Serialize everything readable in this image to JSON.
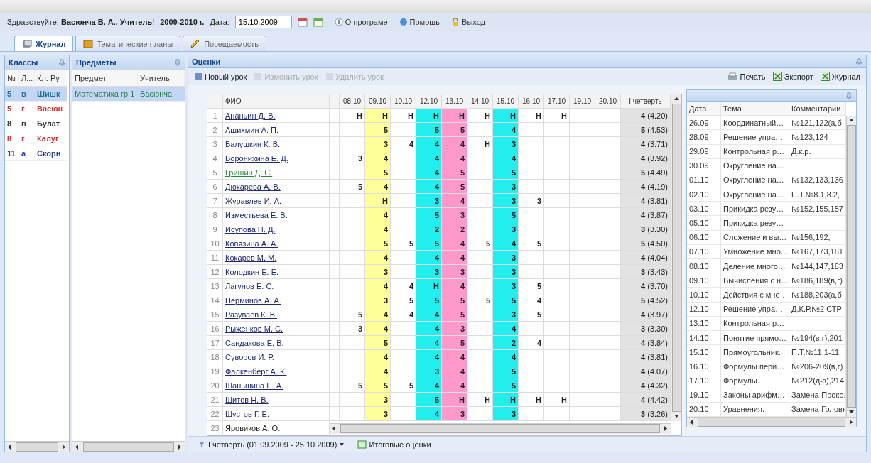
{
  "header": {
    "greeting": "Здравствуйте, **Васюнча В. А., Учитель**!",
    "year": "2009-2010 г.",
    "date_label": "Дата:",
    "date_value": "15.10.2009",
    "links": [
      "О програме",
      "Помощь",
      "Выход"
    ]
  },
  "tabs": [
    {
      "label": "Журнал",
      "selected": true
    },
    {
      "label": "Тематические планы",
      "selected": false
    },
    {
      "label": "Посещаемость",
      "selected": false
    }
  ],
  "classes": {
    "title": "Классы",
    "columns": [
      "№",
      "Л...",
      "Кл. Ру"
    ],
    "rows": [
      {
        "cells": [
          "5",
          "в",
          "Шишк"
        ],
        "color": "#2a6f9a",
        "selected": true
      },
      {
        "cells": [
          "5",
          "г",
          "Васюн"
        ],
        "color": "#d03030",
        "selected": false
      },
      {
        "cells": [
          "8",
          "в",
          "Булат"
        ],
        "color": "#333333",
        "selected": false
      },
      {
        "cells": [
          "8",
          "г",
          "Калуг"
        ],
        "color": "#d03030",
        "selected": false
      },
      {
        "cells": [
          "11",
          "а",
          "Скорн"
        ],
        "color": "#2a3f9a",
        "selected": false
      }
    ]
  },
  "subjects": {
    "title": "Предметы",
    "columns": [
      "Предмет",
      "Учитель"
    ],
    "rows": [
      {
        "cells": [
          "Математика гр 1",
          "Васюнча"
        ],
        "selected": true
      }
    ]
  },
  "grades": {
    "title": "Оценки",
    "toolbar": [
      {
        "label": "Новый урок",
        "disabled": false
      },
      {
        "label": "Изменить урок",
        "disabled": true
      },
      {
        "label": "Удалить урок",
        "disabled": true
      }
    ],
    "actions": [
      "Печать",
      "Экспорт",
      "Журнал"
    ],
    "name_header": "ФИО",
    "columns": [
      {
        "label": "08.10"
      },
      {
        "label": "09.10",
        "color": "#ffff99"
      },
      {
        "label": "10.10"
      },
      {
        "label": "12.10",
        "color": "#22eeee"
      },
      {
        "label": "13.10",
        "color": "#ff99cc"
      },
      {
        "label": "14.10"
      },
      {
        "label": "15.10",
        "color": "#22eeee"
      },
      {
        "label": "16.10"
      },
      {
        "label": "17.10"
      },
      {
        "label": "19.10"
      },
      {
        "label": "20.10"
      }
    ],
    "quarter_header": "I четверть",
    "rows": [
      {
        "num": "1",
        "name": "Ананьин Д. В.",
        "kind": "link",
        "marks": [
          {
            "kind": "grade",
            "text": "Н"
          },
          {
            "kind": "grade",
            "text": "Н"
          },
          {
            "kind": "grade",
            "text": "Н"
          },
          {
            "kind": "grade",
            "text": "Н"
          },
          {
            "kind": "grade",
            "text": "Н"
          },
          {
            "kind": "grade",
            "text": "Н"
          },
          {
            "kind": "grade",
            "text": "Н"
          },
          {
            "kind": "grade",
            "text": "Н"
          },
          {
            "kind": "grade",
            "text": "Н"
          }
        ],
        "quarter": "**4** (4.20)"
      },
      {
        "num": "2",
        "name": "Ашихмин А. П.",
        "kind": "link",
        "marks": [
          {
            "kind": "blank"
          },
          {
            "kind": "grade",
            "text": "5"
          },
          {
            "kind": "blank"
          },
          {
            "kind": "grade",
            "text": "5"
          },
          {
            "kind": "grade",
            "text": "5"
          },
          {
            "kind": "blank"
          },
          {
            "kind": "grade",
            "text": "4"
          }
        ],
        "quarter": "**5** (4.53)"
      },
      {
        "num": "3",
        "name": "Балушкин К. В.",
        "kind": "link",
        "marks": [
          {
            "kind": "blank"
          },
          {
            "kind": "grade",
            "text": "3"
          },
          {
            "kind": "grade",
            "text": "4"
          },
          {
            "kind": "grade",
            "text": "4"
          },
          {
            "kind": "grade",
            "text": "4"
          },
          {
            "kind": "grade",
            "text": "Н"
          },
          {
            "kind": "grade",
            "text": "3"
          }
        ],
        "quarter": "**4** (3.71)"
      },
      {
        "num": "4",
        "name": "Воронихина Е. Д.",
        "kind": "link",
        "marks": [
          {
            "kind": "grade",
            "text": "3"
          },
          {
            "kind": "grade",
            "text": "4"
          },
          {
            "kind": "blank"
          },
          {
            "kind": "grade",
            "text": "4"
          },
          {
            "kind": "grade",
            "text": "4"
          },
          {
            "kind": "blank"
          },
          {
            "kind": "grade",
            "text": "4"
          }
        ],
        "quarter": "**4** (3.92)"
      },
      {
        "num": "5",
        "name": "Гришин Д. С.",
        "kind": "visited",
        "marks": [
          {
            "kind": "blank"
          },
          {
            "kind": "grade",
            "text": "5"
          },
          {
            "kind": "blank"
          },
          {
            "kind": "grade",
            "text": "4"
          },
          {
            "kind": "grade",
            "text": "5"
          },
          {
            "kind": "blank"
          },
          {
            "kind": "grade",
            "text": "5"
          }
        ],
        "quarter": "**5** (4.49)"
      },
      {
        "num": "6",
        "name": "Дюкарева А. В.",
        "kind": "link",
        "marks": [
          {
            "kind": "grade",
            "text": "5"
          },
          {
            "kind": "grade",
            "text": "4"
          },
          {
            "kind": "blank"
          },
          {
            "kind": "grade",
            "text": "4"
          },
          {
            "kind": "grade",
            "text": "5"
          },
          {
            "kind": "blank"
          },
          {
            "kind": "grade",
            "text": "3"
          }
        ],
        "quarter": "**4** (4.19)"
      },
      {
        "num": "7",
        "name": "Журавлев И. А.",
        "kind": "link",
        "marks": [
          {
            "kind": "blank"
          },
          {
            "kind": "grade",
            "text": "Н"
          },
          {
            "kind": "blank"
          },
          {
            "kind": "grade",
            "text": "3"
          },
          {
            "kind": "grade",
            "text": "4"
          },
          {
            "kind": "blank"
          },
          {
            "kind": "grade",
            "text": "3"
          },
          {
            "kind": "grade",
            "text": "3"
          }
        ],
        "quarter": "**4** (3.81)"
      },
      {
        "num": "8",
        "name": "Изместьева Е. В.",
        "kind": "link",
        "marks": [
          {
            "kind": "blank"
          },
          {
            "kind": "grade",
            "text": "4"
          },
          {
            "kind": "blank"
          },
          {
            "kind": "grade",
            "text": "5"
          },
          {
            "kind": "grade",
            "text": "3"
          },
          {
            "kind": "blank"
          },
          {
            "kind": "grade",
            "text": "5"
          }
        ],
        "quarter": "**4** (3.87)"
      },
      {
        "num": "9",
        "name": "Исупова П. Д.",
        "kind": "link",
        "marks": [
          {
            "kind": "blank"
          },
          {
            "kind": "grade",
            "text": "4"
          },
          {
            "kind": "blank"
          },
          {
            "kind": "grade",
            "text": "2"
          },
          {
            "kind": "grade",
            "text": "2"
          },
          {
            "kind": "blank"
          },
          {
            "kind": "grade",
            "text": "3"
          }
        ],
        "quarter": "**3** (3.30)"
      },
      {
        "num": "10",
        "name": "Ковязина А. А.",
        "kind": "link",
        "marks": [
          {
            "kind": "blank"
          },
          {
            "kind": "grade",
            "text": "5"
          },
          {
            "kind": "grade",
            "text": "5"
          },
          {
            "kind": "grade",
            "text": "5"
          },
          {
            "kind": "grade",
            "text": "4"
          },
          {
            "kind": "grade",
            "text": "5"
          },
          {
            "kind": "grade",
            "text": "4"
          },
          {
            "kind": "grade",
            "text": "5"
          }
        ],
        "quarter": "**5** (4.50)"
      },
      {
        "num": "11",
        "name": "Кокарев М. М.",
        "kind": "link",
        "marks": [
          {
            "kind": "blank"
          },
          {
            "kind": "grade",
            "text": "4"
          },
          {
            "kind": "blank"
          },
          {
            "kind": "grade",
            "text": "4"
          },
          {
            "kind": "grade",
            "text": "4"
          },
          {
            "kind": "blank"
          },
          {
            "kind": "grade",
            "text": "3"
          }
        ],
        "quarter": "**4** (4.04)"
      },
      {
        "num": "12",
        "name": "Колодкин Е. Е.",
        "kind": "link",
        "marks": [
          {
            "kind": "blank"
          },
          {
            "kind": "grade",
            "text": "3"
          },
          {
            "kind": "blank"
          },
          {
            "kind": "grade",
            "text": "3"
          },
          {
            "kind": "grade",
            "text": "3"
          },
          {
            "kind": "blank"
          },
          {
            "kind": "grade",
            "text": "3"
          }
        ],
        "quarter": "**3** (3.43)"
      },
      {
        "num": "13",
        "name": "Лагунов Е. С.",
        "kind": "link",
        "marks": [
          {
            "kind": "blank"
          },
          {
            "kind": "grade",
            "text": "4"
          },
          {
            "kind": "grade",
            "text": "4"
          },
          {
            "kind": "grade",
            "text": "Н"
          },
          {
            "kind": "grade",
            "text": "4"
          },
          {
            "kind": "blank"
          },
          {
            "kind": "grade",
            "text": "3"
          },
          {
            "kind": "grade",
            "text": "5"
          }
        ],
        "quarter": "**4** (3.70)"
      },
      {
        "num": "14",
        "name": "Перминов А. А.",
        "kind": "link",
        "marks": [
          {
            "kind": "blank"
          },
          {
            "kind": "grade",
            "text": "3"
          },
          {
            "kind": "grade",
            "text": "5"
          },
          {
            "kind": "grade",
            "text": "5"
          },
          {
            "kind": "grade",
            "text": "5"
          },
          {
            "kind": "grade",
            "text": "5"
          },
          {
            "kind": "grade",
            "text": "5"
          },
          {
            "kind": "grade",
            "text": "4"
          }
        ],
        "quarter": "**5** (4.52)"
      },
      {
        "num": "15",
        "name": "Разуваев К. В.",
        "kind": "link",
        "marks": [
          {
            "kind": "grade",
            "text": "5"
          },
          {
            "kind": "grade",
            "text": "4"
          },
          {
            "kind": "grade",
            "text": "4"
          },
          {
            "kind": "grade",
            "text": "4"
          },
          {
            "kind": "grade",
            "text": "5"
          },
          {
            "kind": "blank"
          },
          {
            "kind": "grade",
            "text": "3"
          },
          {
            "kind": "grade",
            "text": "5"
          }
        ],
        "quarter": "**4** (3.97)"
      },
      {
        "num": "16",
        "name": "Рыженков М. С.",
        "kind": "link",
        "marks": [
          {
            "kind": "grade",
            "text": "3"
          },
          {
            "kind": "grade",
            "text": "4"
          },
          {
            "kind": "blank"
          },
          {
            "kind": "grade",
            "text": "4"
          },
          {
            "kind": "grade",
            "text": "3"
          },
          {
            "kind": "blank"
          },
          {
            "kind": "grade",
            "text": "4"
          }
        ],
        "quarter": "**3** (3.30)"
      },
      {
        "num": "17",
        "name": "Сандакова Е. В.",
        "kind": "link",
        "marks": [
          {
            "kind": "blank"
          },
          {
            "kind": "grade",
            "text": "5"
          },
          {
            "kind": "blank"
          },
          {
            "kind": "grade",
            "text": "4"
          },
          {
            "kind": "grade",
            "text": "5"
          },
          {
            "kind": "blank"
          },
          {
            "kind": "grade",
            "text": "2"
          },
          {
            "kind": "grade",
            "text": "4"
          }
        ],
        "quarter": "**4** (3.84)"
      },
      {
        "num": "18",
        "name": "Суворов И. Р.",
        "kind": "link",
        "marks": [
          {
            "kind": "blank"
          },
          {
            "kind": "grade",
            "text": "4"
          },
          {
            "kind": "blank"
          },
          {
            "kind": "grade",
            "text": "4"
          },
          {
            "kind": "grade",
            "text": "4"
          },
          {
            "kind": "blank"
          },
          {
            "kind": "grade",
            "text": "4"
          }
        ],
        "quarter": "**4** (3.81)"
      },
      {
        "num": "19",
        "name": "Фалкенберг А. К.",
        "kind": "link",
        "marks": [
          {
            "kind": "blank"
          },
          {
            "kind": "grade",
            "text": "4"
          },
          {
            "kind": "blank"
          },
          {
            "kind": "grade",
            "text": "3"
          },
          {
            "kind": "grade",
            "text": "4"
          },
          {
            "kind": "blank"
          },
          {
            "kind": "grade",
            "text": "5"
          }
        ],
        "quarter": "**4** (4.07)"
      },
      {
        "num": "20",
        "name": "Шаньшина Е. А.",
        "kind": "link",
        "marks": [
          {
            "kind": "grade",
            "text": "5"
          },
          {
            "kind": "grade",
            "text": "5"
          },
          {
            "kind": "grade",
            "text": "5"
          },
          {
            "kind": "grade",
            "text": "4"
          },
          {
            "kind": "grade",
            "text": "4"
          },
          {
            "kind": "blank"
          },
          {
            "kind": "grade",
            "text": "5"
          }
        ],
        "quarter": "**4** (4.32)"
      },
      {
        "num": "21",
        "name": "Шитов Н. В.",
        "kind": "link",
        "marks": [
          {
            "kind": "blank"
          },
          {
            "kind": "grade",
            "text": "3"
          },
          {
            "kind": "blank"
          },
          {
            "kind": "grade",
            "text": "5"
          },
          {
            "kind": "grade",
            "text": "Н"
          },
          {
            "kind": "grade",
            "text": "Н"
          },
          {
            "kind": "grade",
            "text": "Н"
          },
          {
            "kind": "grade",
            "text": "Н"
          },
          {
            "kind": "grade",
            "text": "Н"
          }
        ],
        "quarter": "**4** (4.42)"
      },
      {
        "num": "22",
        "name": "Шустов Г. Е.",
        "kind": "link",
        "marks": [
          {
            "kind": "blank"
          },
          {
            "kind": "grade",
            "text": "3"
          },
          {
            "kind": "blank"
          },
          {
            "kind": "grade",
            "text": "4"
          },
          {
            "kind": "grade",
            "text": "3"
          },
          {
            "kind": "blank"
          },
          {
            "kind": "grade",
            "text": "3"
          }
        ],
        "quarter": "**3** (3.26)"
      },
      {
        "num": "23",
        "name": "Яровиков А. О.",
        "kind": "plain"
      }
    ],
    "period": "I четверть (01.09.2009 - 25.10.2009)",
    "totals": "Итоговые оценки"
  },
  "lessons": {
    "columns": [
      "Дата",
      "Тема",
      "Комментарии"
    ],
    "rows": [
      {
        "date": "26.09",
        "topic": "Координатный…",
        "comment": "№121,122(а,б"
      },
      {
        "date": "28.09",
        "topic": "Решение упра…",
        "comment": "№123,124"
      },
      {
        "date": "29.09",
        "topic": "Контрольная р…",
        "comment": "Д.к.р."
      },
      {
        "date": "30.09",
        "topic": "Округление на…"
      },
      {
        "date": "01.10",
        "topic": "Округление на…",
        "comment": "№132,133,136"
      },
      {
        "date": "02.10",
        "topic": "Округление на…",
        "comment": "П.Т.№8.1,8.2,"
      },
      {
        "date": "03.10",
        "topic": "Прикидка резу…",
        "comment": "№152,155,157"
      },
      {
        "date": "05.10",
        "topic": "Прикидка резу…"
      },
      {
        "date": "06.10",
        "topic": "Сложение и вы…",
        "comment": "№156,192,"
      },
      {
        "date": "07.10",
        "topic": "Умножение мно…",
        "comment": "№167,173,181"
      },
      {
        "date": "08.10",
        "topic": "Деление много…",
        "comment": "№144,147,183"
      },
      {
        "date": "09.10",
        "topic": "Вычисления с н…",
        "comment": "№186,189(в,г)"
      },
      {
        "date": "10.10",
        "topic": "Действия с мно…",
        "comment": "№188,203(а,б"
      },
      {
        "date": "12.10",
        "topic": "Решение упра…",
        "comment": "Д.К.Р.№2 СТР"
      },
      {
        "date": "13.10",
        "topic": "Контрольная р…"
      },
      {
        "date": "14.10",
        "topic": "Понятие прямо…",
        "comment": "№194(в,г),201"
      },
      {
        "date": "15.10",
        "topic": "Прямоугольник.",
        "comment": "П.Т.№11.1-11."
      },
      {
        "date": "16.10",
        "topic": "Формулы пери…",
        "comment": "№206-209(в,г)"
      },
      {
        "date": "17.10",
        "topic": "Формулы.",
        "comment": "№212(д-з),214"
      },
      {
        "date": "19.10",
        "topic": "Законы арифм…",
        "comment": "Замена-Проко."
      },
      {
        "date": "20.10",
        "topic": "Уравнения.",
        "comment": "Замена-Головн"
      }
    ]
  }
}
